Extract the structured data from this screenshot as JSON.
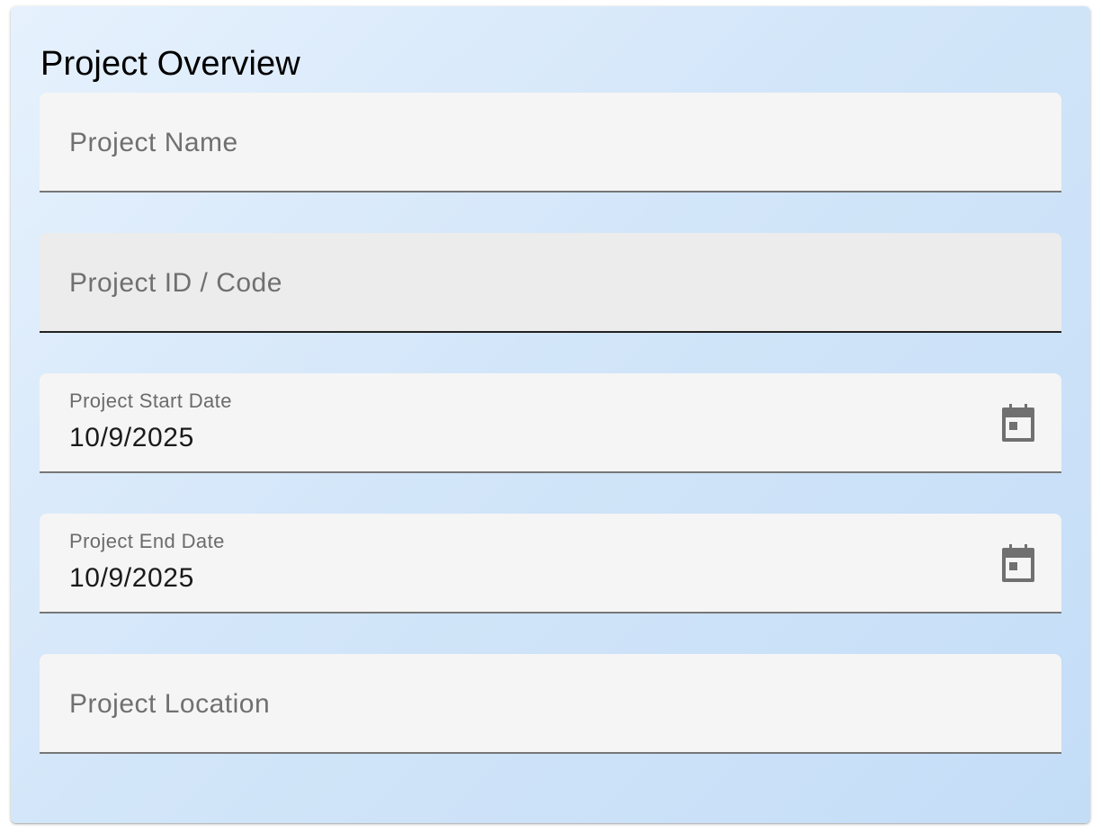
{
  "form": {
    "title": "Project Overview",
    "fields": [
      {
        "name": "project-name",
        "placeholder": "Project Name",
        "value": ""
      },
      {
        "name": "project-id",
        "placeholder": "Project ID / Code",
        "value": "",
        "focused": true
      },
      {
        "name": "project-start-date",
        "label": "Project Start Date",
        "value": "10/9/2025",
        "icon": "calendar-icon"
      },
      {
        "name": "project-end-date",
        "label": "Project End Date",
        "value": "10/9/2025",
        "icon": "calendar-icon"
      },
      {
        "name": "project-location",
        "placeholder": "Project Location",
        "value": ""
      }
    ]
  },
  "colors": {
    "field_bg": "#f5f5f5",
    "field_focused_bg": "#ececec",
    "underline": "#777777",
    "icon": "#707070"
  }
}
